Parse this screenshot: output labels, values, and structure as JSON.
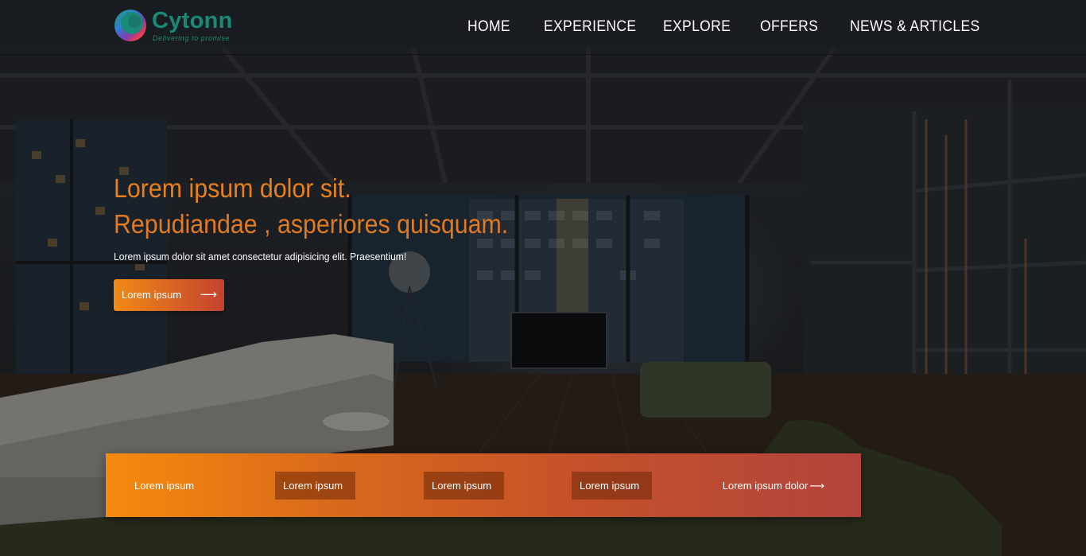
{
  "brand": {
    "name": "Cytonn",
    "tagline": "Delivering to promise"
  },
  "nav": [
    {
      "label": "HOME"
    },
    {
      "label": "EXPERIENCE"
    },
    {
      "label": "EXPLORE"
    },
    {
      "label": "OFFERS"
    },
    {
      "label": "NEWS & ARTICLES"
    }
  ],
  "hero": {
    "title_line1": "Lorem ipsum dolor sit.",
    "title_line2": "Repudiandae , asperiores quisquam.",
    "subtitle": "Lorem ipsum dolor sit amet consectetur adipisicing elit. Praesentium!",
    "cta_label": "Lorem ipsum",
    "cta_arrow": "⟶"
  },
  "bottom_bar": {
    "items": [
      {
        "label": "Lorem ipsum"
      },
      {
        "label": "Lorem ipsum"
      },
      {
        "label": "Lorem ipsum"
      },
      {
        "label": "Lorem ipsum"
      }
    ],
    "cta_label": "Lorem ipsum dolor",
    "cta_arrow": "⟶"
  },
  "colors": {
    "accent_orange": "#f68a0c",
    "accent_red": "#b2443d",
    "brand_teal": "#1a8a78",
    "headline": "#e8811c"
  }
}
